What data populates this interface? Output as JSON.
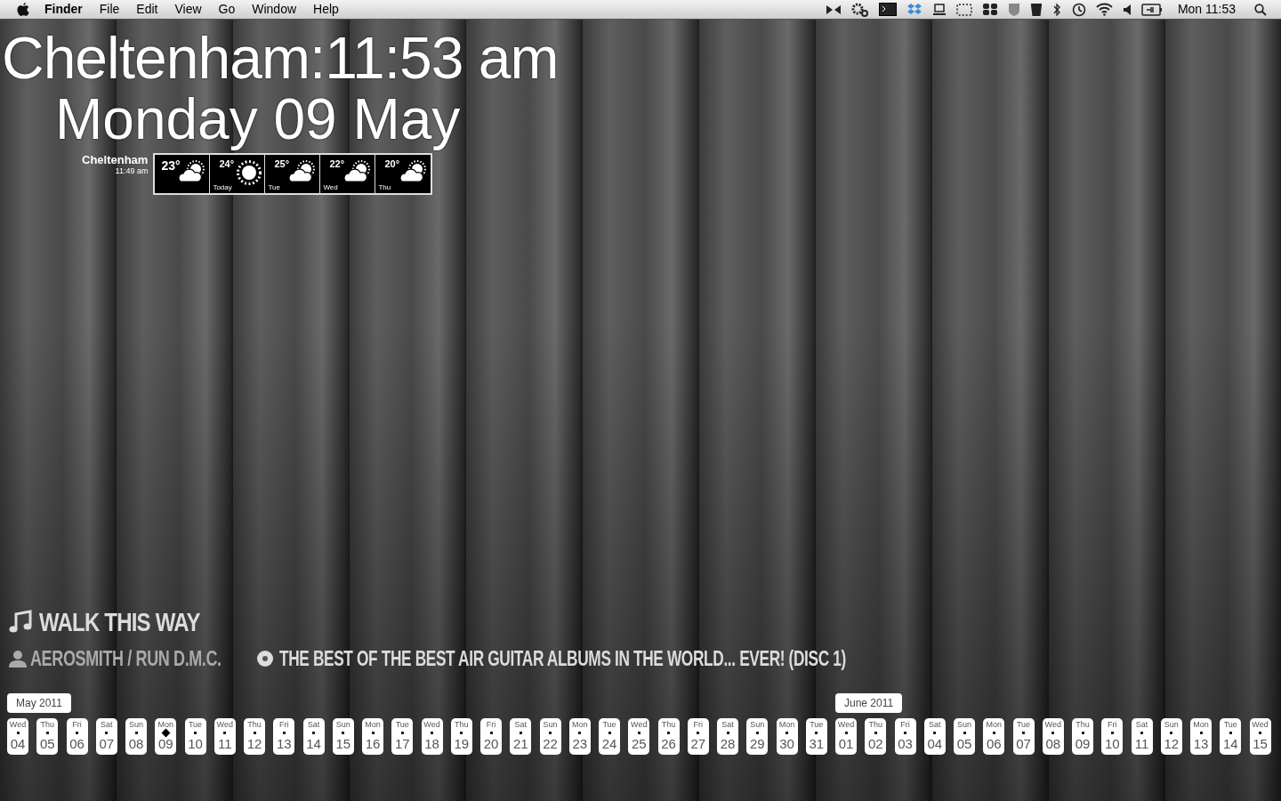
{
  "menu_bar": {
    "app": "Finder",
    "menus": [
      "File",
      "Edit",
      "View",
      "Go",
      "Window",
      "Help"
    ],
    "clock": "Mon 11:53"
  },
  "clock_widget": {
    "time": "Cheltenham:11:53 am",
    "date": "Monday 09 May"
  },
  "weather": {
    "location": "Cheltenham",
    "updated": "11:49 am",
    "days": [
      {
        "temp": "23°",
        "kind": "partly-cloudy"
      },
      {
        "temp": "24°",
        "kind": "sunny",
        "label": "Today"
      },
      {
        "temp": "25°",
        "kind": "partly-cloudy",
        "label": "Tue"
      },
      {
        "temp": "22°",
        "kind": "partly-cloudy",
        "label": "Wed"
      },
      {
        "temp": "20°",
        "kind": "partly-cloudy",
        "label": "Thu"
      }
    ]
  },
  "now_playing": {
    "title": "WALK THIS WAY",
    "artist": "AEROSMITH / RUN D.M.C.",
    "album": "THE BEST OF THE BEST AIR GUITAR ALBUMS IN THE WORLD... EVER! (DISC 1)"
  },
  "calendar": {
    "months": [
      {
        "label": "May 2011",
        "days": [
          {
            "weekday": "Wed",
            "date": "04",
            "selected": false
          },
          {
            "weekday": "Thu",
            "date": "05",
            "selected": false
          },
          {
            "weekday": "Fri",
            "date": "06",
            "selected": false
          },
          {
            "weekday": "Sat",
            "date": "07",
            "selected": false
          },
          {
            "weekday": "Sun",
            "date": "08",
            "selected": false
          },
          {
            "weekday": "Mon",
            "date": "09",
            "selected": true
          },
          {
            "weekday": "Tue",
            "date": "10",
            "selected": false
          },
          {
            "weekday": "Wed",
            "date": "11",
            "selected": false
          },
          {
            "weekday": "Thu",
            "date": "12",
            "selected": false
          },
          {
            "weekday": "Fri",
            "date": "13",
            "selected": false
          },
          {
            "weekday": "Sat",
            "date": "14",
            "selected": false
          },
          {
            "weekday": "Sun",
            "date": "15",
            "selected": false
          },
          {
            "weekday": "Mon",
            "date": "16",
            "selected": false
          },
          {
            "weekday": "Tue",
            "date": "17",
            "selected": false
          },
          {
            "weekday": "Wed",
            "date": "18",
            "selected": false
          },
          {
            "weekday": "Thu",
            "date": "19",
            "selected": false
          },
          {
            "weekday": "Fri",
            "date": "20",
            "selected": false
          },
          {
            "weekday": "Sat",
            "date": "21",
            "selected": false
          },
          {
            "weekday": "Sun",
            "date": "22",
            "selected": false
          },
          {
            "weekday": "Mon",
            "date": "23",
            "selected": false
          },
          {
            "weekday": "Tue",
            "date": "24",
            "selected": false
          },
          {
            "weekday": "Wed",
            "date": "25",
            "selected": false
          },
          {
            "weekday": "Thu",
            "date": "26",
            "selected": false
          },
          {
            "weekday": "Fri",
            "date": "27",
            "selected": false
          },
          {
            "weekday": "Sat",
            "date": "28",
            "selected": false
          },
          {
            "weekday": "Sun",
            "date": "29",
            "selected": false
          },
          {
            "weekday": "Mon",
            "date": "30",
            "selected": false
          },
          {
            "weekday": "Tue",
            "date": "31",
            "selected": false
          }
        ]
      },
      {
        "label": "June 2011",
        "days": [
          {
            "weekday": "Wed",
            "date": "01",
            "selected": false
          },
          {
            "weekday": "Thu",
            "date": "02",
            "selected": false
          },
          {
            "weekday": "Fri",
            "date": "03",
            "selected": false
          },
          {
            "weekday": "Sat",
            "date": "04",
            "selected": false
          },
          {
            "weekday": "Sun",
            "date": "05",
            "selected": false
          },
          {
            "weekday": "Mon",
            "date": "06",
            "selected": false
          },
          {
            "weekday": "Tue",
            "date": "07",
            "selected": false
          },
          {
            "weekday": "Wed",
            "date": "08",
            "selected": false
          },
          {
            "weekday": "Thu",
            "date": "09",
            "selected": false
          },
          {
            "weekday": "Fri",
            "date": "10",
            "selected": false
          },
          {
            "weekday": "Sat",
            "date": "11",
            "selected": false
          },
          {
            "weekday": "Sun",
            "date": "12",
            "selected": false
          },
          {
            "weekday": "Mon",
            "date": "13",
            "selected": false
          },
          {
            "weekday": "Tue",
            "date": "14",
            "selected": false
          },
          {
            "weekday": "Wed",
            "date": "15",
            "selected": false
          }
        ]
      }
    ]
  }
}
